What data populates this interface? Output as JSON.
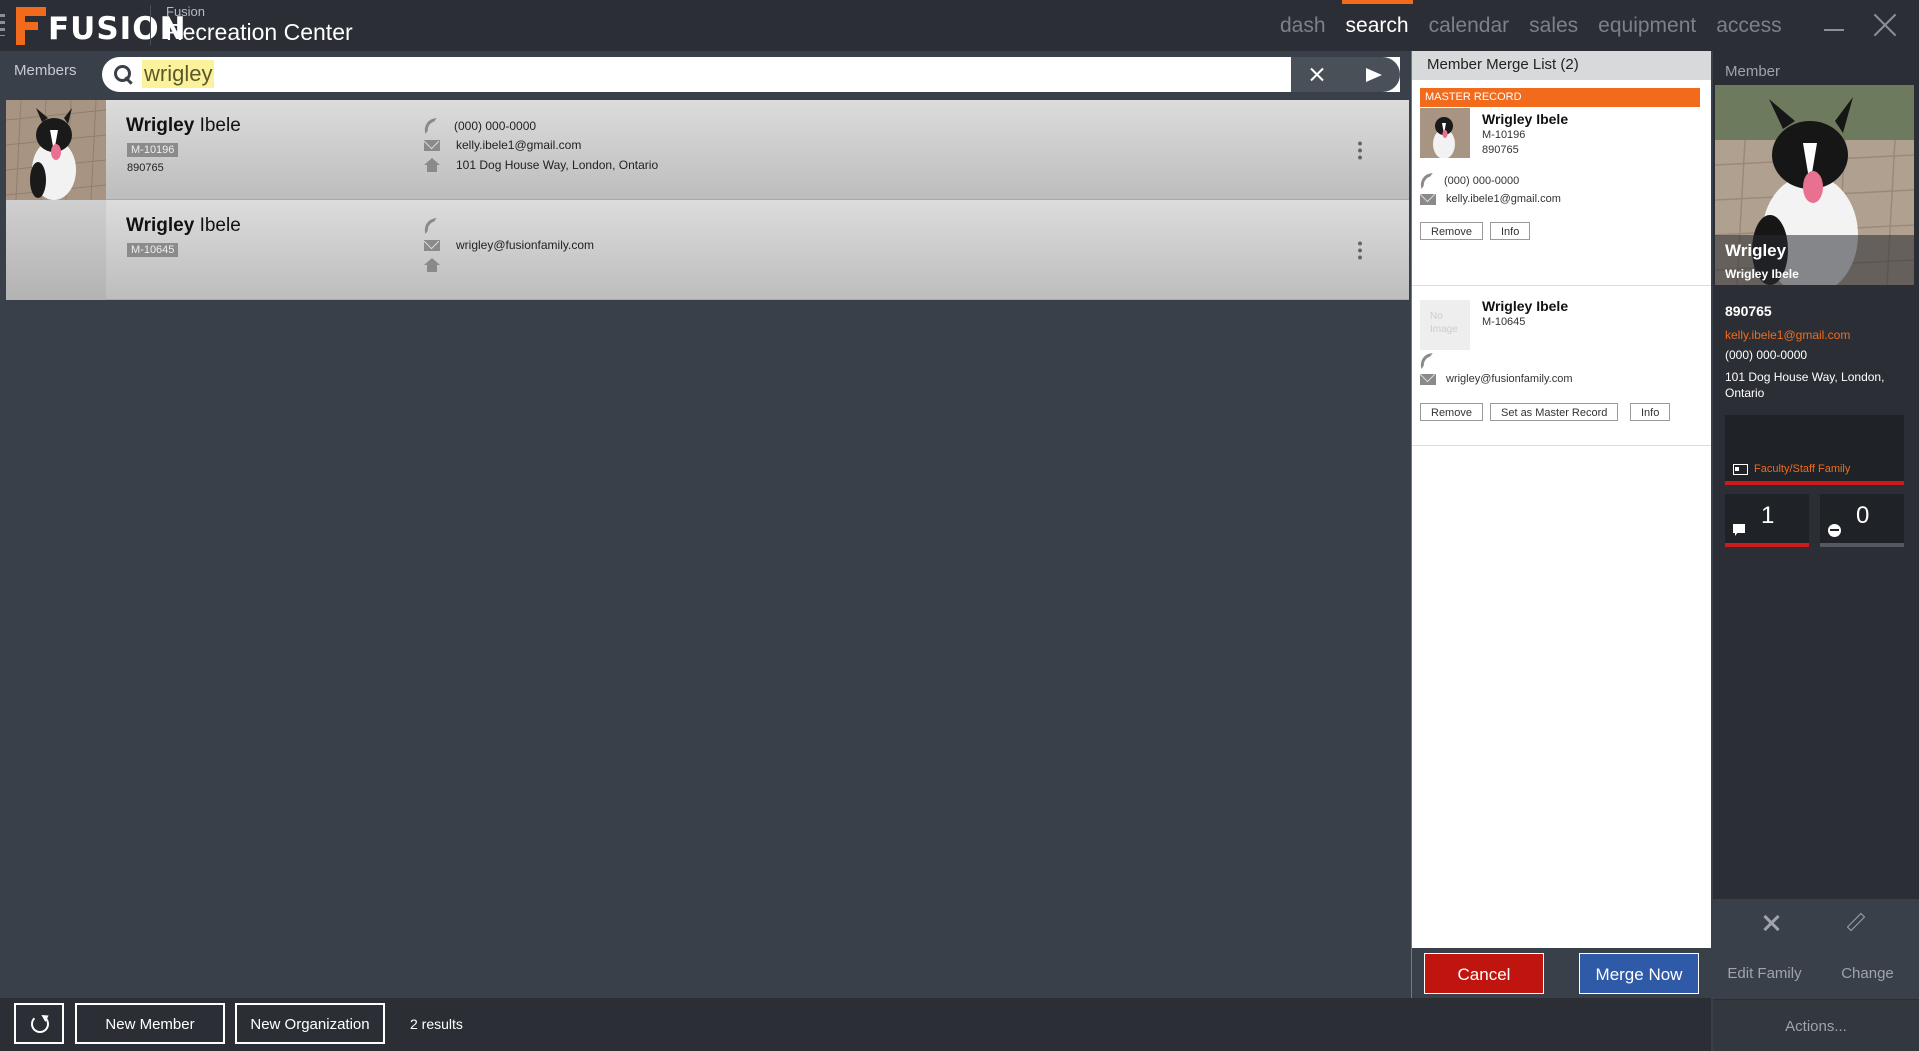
{
  "app": {
    "brand": "FUSION",
    "subtitle": "Fusion",
    "title": "Recreation Center"
  },
  "nav": [
    {
      "label": "dash",
      "active": false
    },
    {
      "label": "search",
      "active": true
    },
    {
      "label": "calendar",
      "active": false
    },
    {
      "label": "sales",
      "active": false
    },
    {
      "label": "equipment",
      "active": false
    },
    {
      "label": "access",
      "active": false
    }
  ],
  "search": {
    "scope_label": "Members",
    "value": "wrigley"
  },
  "results": [
    {
      "first": "Wrigley",
      "last": "Ibele",
      "member_id": "M-10196",
      "number": "890765",
      "phone": "(000) 000-0000",
      "email": "kelly.ibele1@gmail.com",
      "address": "101 Dog House Way, London, Ontario",
      "has_photo": true
    },
    {
      "first": "Wrigley",
      "last": "Ibele",
      "member_id": "M-10645",
      "number": "",
      "phone": "",
      "email": "wrigley@fusionfamily.com",
      "address": "",
      "has_photo": false
    }
  ],
  "merge": {
    "title": "Member Merge List (2)",
    "master_tag": "MASTER RECORD",
    "no_image": "No Image",
    "records": [
      {
        "name": "Wrigley Ibele",
        "member_id": "M-10196",
        "number": "890765",
        "phone": "(000) 000-0000",
        "email": "kelly.ibele1@gmail.com"
      },
      {
        "name": "Wrigley Ibele",
        "member_id": "M-10645",
        "number": "",
        "phone": "",
        "email": "wrigley@fusionfamily.com"
      }
    ],
    "buttons": {
      "remove": "Remove",
      "info": "Info",
      "set_master": "Set as Master Record",
      "cancel": "Cancel",
      "merge_now": "Merge Now"
    }
  },
  "member": {
    "label": "Member",
    "first": "Wrigley",
    "full": "Wrigley Ibele",
    "number": "890765",
    "email": "kelly.ibele1@gmail.com",
    "phone": "(000) 000-0000",
    "address": "101 Dog House Way, London, Ontario",
    "membership": "Faculty/Staff Family",
    "messages_count": "1",
    "activities_count": "0",
    "edit_family": "Edit Family",
    "change": "Change",
    "actions": "Actions..."
  },
  "bottom": {
    "new_member": "New Member",
    "new_organization": "New Organization",
    "results_count": "2 results"
  },
  "colors": {
    "accent": "#f26a1b",
    "cancel": "#c0150f",
    "merge": "#2e5aa8",
    "background": "#3a4049"
  }
}
